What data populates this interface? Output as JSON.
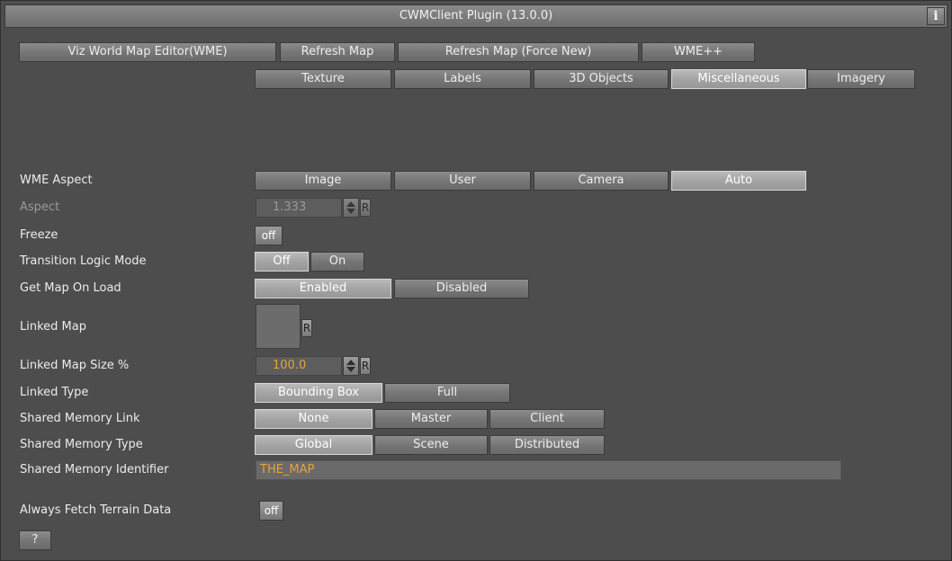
{
  "window": {
    "title": "CWMClient Plugin (13.0.0)",
    "info_label": "i"
  },
  "top_buttons": [
    {
      "label": "Viz World Map Editor(WME)"
    },
    {
      "label": "Refresh Map"
    },
    {
      "label": "Refresh Map (Force New)"
    },
    {
      "label": "WME++"
    }
  ],
  "tabs": [
    {
      "label": "Texture",
      "active": false
    },
    {
      "label": "Labels",
      "active": false
    },
    {
      "label": "3D Objects",
      "active": false
    },
    {
      "label": "Miscellaneous",
      "active": true
    },
    {
      "label": "Imagery",
      "active": false
    }
  ],
  "wme_aspect": {
    "label": "WME Aspect",
    "options": [
      "Image",
      "User",
      "Camera",
      "Auto"
    ],
    "selected": "Auto"
  },
  "aspect": {
    "label": "Aspect",
    "value": "1.333",
    "reset": "R"
  },
  "freeze": {
    "label": "Freeze",
    "value": "off"
  },
  "transition_logic": {
    "label": "Transition Logic Mode",
    "options": [
      "Off",
      "On"
    ],
    "selected": "Off"
  },
  "get_map_on_load": {
    "label": "Get Map On Load",
    "options": [
      "Enabled",
      "Disabled"
    ],
    "selected": "Enabled"
  },
  "linked_map": {
    "label": "Linked Map",
    "reset": "R"
  },
  "linked_map_size": {
    "label": "Linked Map Size %",
    "value": "100.0",
    "reset": "R"
  },
  "linked_type": {
    "label": "Linked Type",
    "options": [
      "Bounding Box",
      "Full"
    ],
    "selected": "Bounding Box"
  },
  "shared_memory_link": {
    "label": "Shared  Memory Link",
    "options": [
      "None",
      "Master",
      "Client"
    ],
    "selected": "None"
  },
  "shared_memory_type": {
    "label": "Shared  Memory Type",
    "options": [
      "Global",
      "Scene",
      "Distributed"
    ],
    "selected": "Global"
  },
  "shared_memory_identifier": {
    "label": "Shared  Memory Identifier",
    "value": "THE_MAP"
  },
  "always_fetch_terrain": {
    "label": "Always Fetch Terrain Data",
    "value": "off"
  },
  "help_button": {
    "label": "?"
  },
  "colors": {
    "accent_value": "#e8a33a",
    "panel_bg": "#4d4d4d",
    "active_button": "#a4a4a4"
  }
}
